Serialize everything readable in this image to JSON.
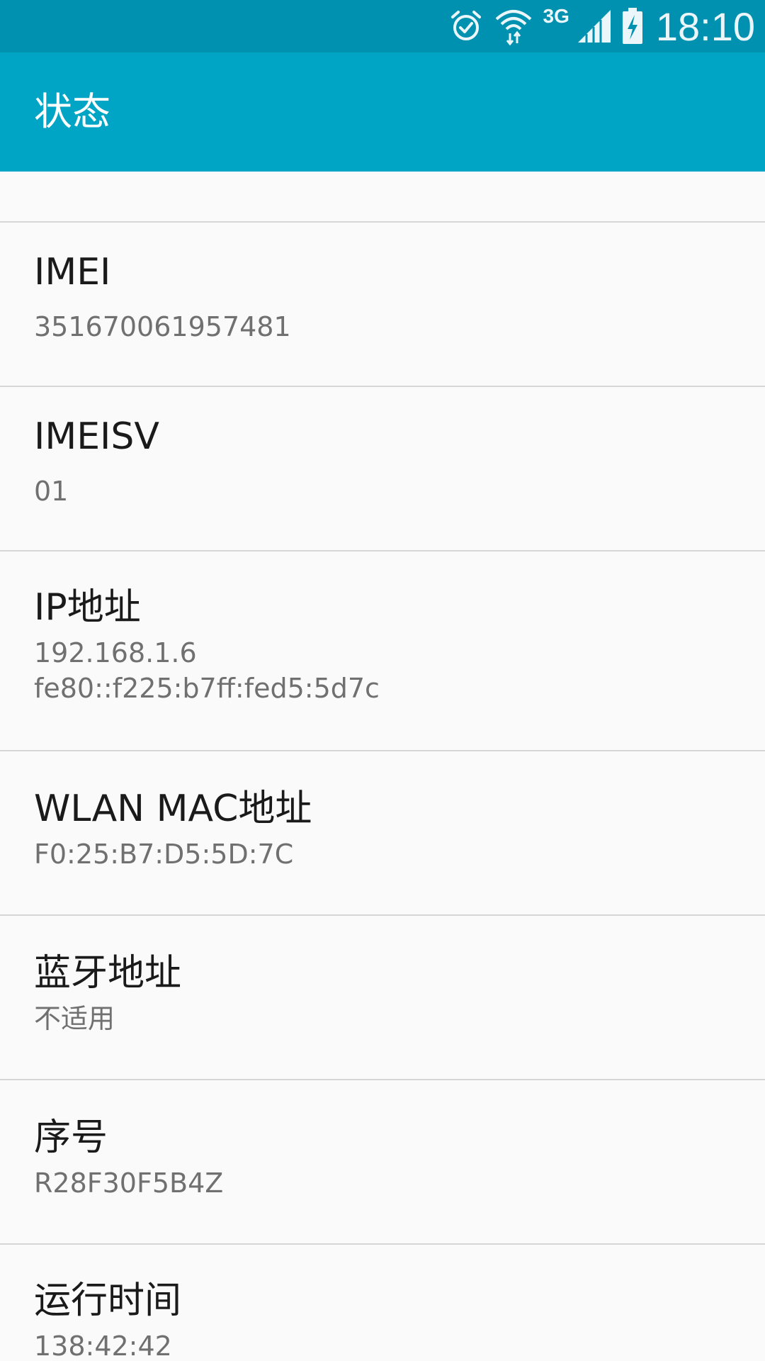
{
  "status_bar": {
    "time": "18:10",
    "network_type": "3G",
    "icons": [
      "alarm-icon",
      "wifi-icon",
      "signal-icon",
      "battery-charging-icon"
    ],
    "color": "#0091b1"
  },
  "app_bar": {
    "title": "状态",
    "color": "#00a4c4"
  },
  "items": [
    {
      "title": "IMEI",
      "value": "351670061957481"
    },
    {
      "title": "IMEISV",
      "value": "01"
    },
    {
      "title": "IP地址",
      "value": "192.168.1.6",
      "value2": "fe80::f225:b7ff:fed5:5d7c"
    },
    {
      "title": "WLAN MAC地址",
      "value": "F0:25:B7:D5:5D:7C"
    },
    {
      "title": "蓝牙地址",
      "value": "不适用"
    },
    {
      "title": "序号",
      "value": "R28F30F5B4Z"
    },
    {
      "title": "运行时间",
      "value": "138:42:42"
    }
  ]
}
